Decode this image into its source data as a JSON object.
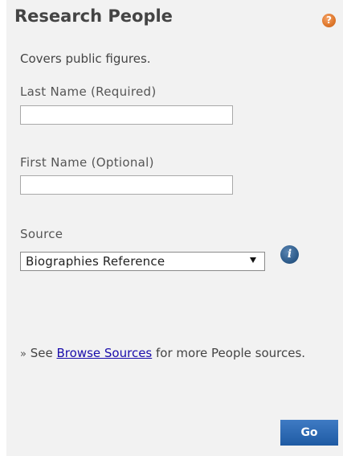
{
  "header": {
    "title": "Research People",
    "help_icon": "question-circle-icon",
    "help_glyph": "?",
    "help_color": "#e07a2e"
  },
  "description": "Covers public figures.",
  "last_name": {
    "label": "Last Name (Required)",
    "value": ""
  },
  "first_name": {
    "label": "First Name (Optional)",
    "value": ""
  },
  "source": {
    "label": "Source",
    "selected": "Biographies Reference",
    "info_icon": "info-circle-icon",
    "info_glyph": "i",
    "info_color": "#2f5d8c"
  },
  "browse": {
    "prefix": "»",
    "see_text": "See",
    "link_text": "Browse Sources",
    "suffix_text": "for more People sources."
  },
  "actions": {
    "go_label": "Go",
    "go_color": "#1f5ba3"
  },
  "colors": {
    "panel_bg": "#f2f2f2",
    "link": "#1a0dab",
    "text": "#444444"
  }
}
